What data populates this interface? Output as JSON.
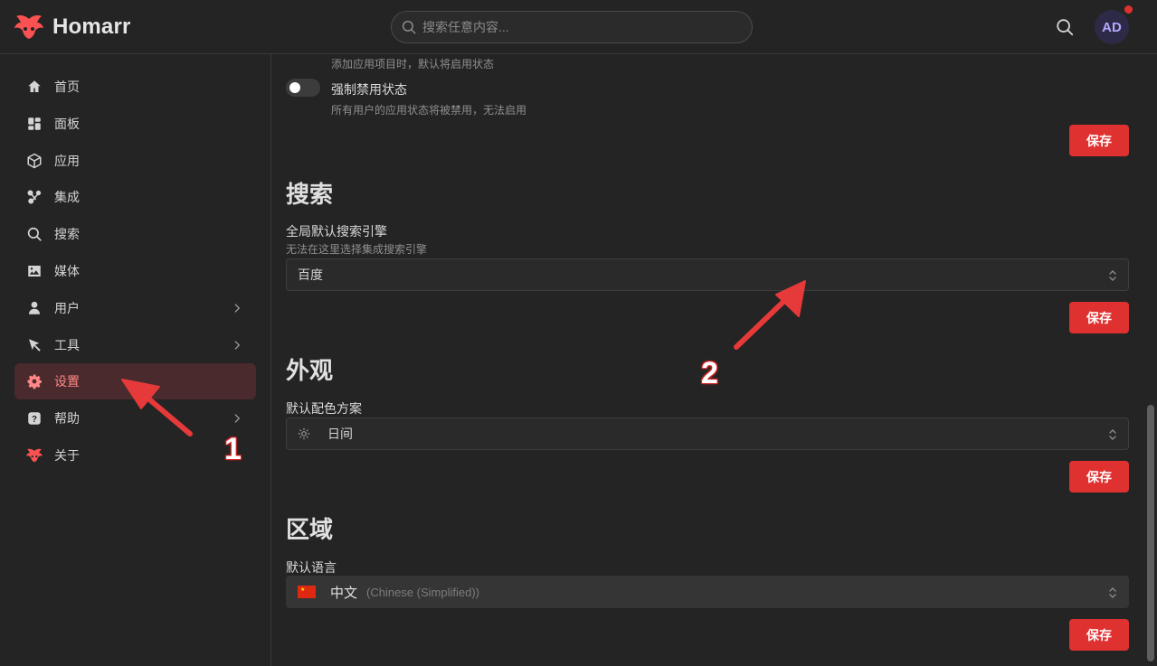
{
  "app": {
    "title": "Homarr"
  },
  "search": {
    "placeholder": "搜索任意内容..."
  },
  "user": {
    "initials": "AD"
  },
  "colors": {
    "accent": "#e03131",
    "active_bg": "#4a2a2c",
    "active_text": "#ff8787"
  },
  "sidebar": {
    "items": [
      {
        "label": "首页",
        "icon": "home-icon"
      },
      {
        "label": "面板",
        "icon": "boards-icon"
      },
      {
        "label": "应用",
        "icon": "box-icon"
      },
      {
        "label": "集成",
        "icon": "integrations-icon"
      },
      {
        "label": "搜索",
        "icon": "search-icon"
      },
      {
        "label": "媒体",
        "icon": "photo-icon"
      },
      {
        "label": "用户",
        "icon": "user-icon"
      },
      {
        "label": "工具",
        "icon": "pointer-icon"
      },
      {
        "label": "设置",
        "icon": "gear-icon"
      },
      {
        "label": "帮助",
        "icon": "help-icon"
      },
      {
        "label": "关于",
        "icon": "homarr-logo-icon"
      }
    ],
    "active": "设置"
  },
  "main": {
    "apps_section": {
      "default_enabled_desc": "添加应用项目时，默认将启用状态",
      "force_disable_label": "强制禁用状态",
      "force_disable_desc": "所有用户的应用状态将被禁用，无法启用",
      "force_disable_on": false,
      "save_label": "保存"
    },
    "search_section": {
      "title": "搜索",
      "field_label": "全局默认搜索引擎",
      "field_desc": "无法在这里选择集成搜索引擎",
      "value": "百度",
      "save_label": "保存"
    },
    "appearance_section": {
      "title": "外观",
      "field_label": "默认配色方案",
      "value": "日间",
      "save_label": "保存"
    },
    "region_section": {
      "title": "区域",
      "field_label": "默认语言",
      "value": "中文",
      "value_sub": "(Chinese (Simplified))",
      "save_label": "保存"
    }
  },
  "annotations": {
    "marker_1": "1",
    "marker_2": "2"
  }
}
